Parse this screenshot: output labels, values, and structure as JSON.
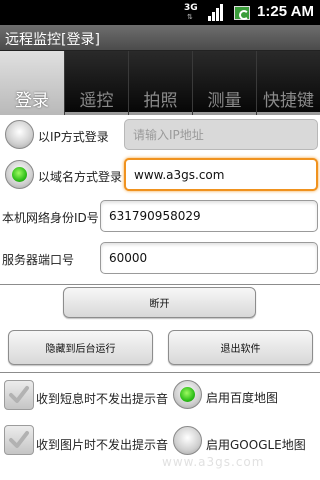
{
  "status_bar": {
    "time": "1:25 AM",
    "network": "3G"
  },
  "app": {
    "title": "远程监控[登录]"
  },
  "tabs": [
    {
      "label": "登录",
      "selected": true
    },
    {
      "label": "遥控",
      "selected": false
    },
    {
      "label": "拍照",
      "selected": false
    },
    {
      "label": "测量",
      "selected": false
    },
    {
      "label": "快捷键",
      "selected": false
    }
  ],
  "login_mode": {
    "ip_label": "以IP方式登录",
    "ip_placeholder": "请输入IP地址",
    "ip_selected": false,
    "domain_label": "以域名方式登录",
    "domain_value": "www.a3gs.com",
    "domain_selected": true
  },
  "identity": {
    "label": "本机网络身份ID号",
    "value": "631790958029"
  },
  "server_port": {
    "label": "服务器端口号",
    "value": "60000"
  },
  "buttons": {
    "disconnect": "断开",
    "hide_background": "隐藏到后台运行",
    "exit": "退出软件"
  },
  "options": {
    "sms_silent": {
      "label": "收到短息时不发出提示音",
      "checked": false
    },
    "baidu_map": {
      "label": "启用百度地图",
      "selected": true
    },
    "image_silent": {
      "label": "收到图片时不发出提示音",
      "checked": false
    },
    "google_map": {
      "label": "启用GOOGLE地图",
      "selected": false
    }
  },
  "watermark": "www.a3gs.com"
}
